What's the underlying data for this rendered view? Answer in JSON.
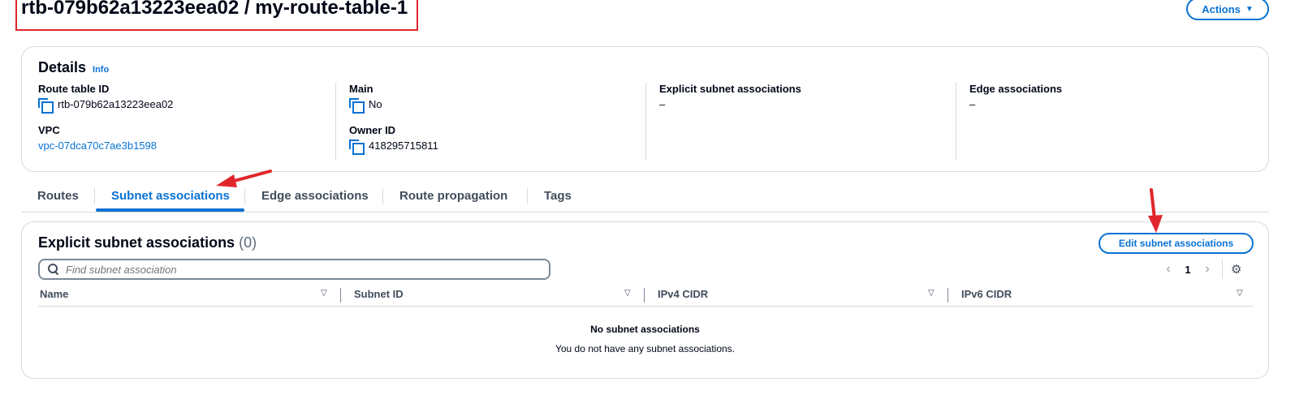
{
  "header": {
    "title": "rtb-079b62a13223eea02 / my-route-table-1",
    "actions_label": "Actions"
  },
  "details": {
    "title": "Details",
    "info_label": "Info",
    "route_table_id_label": "Route table ID",
    "route_table_id_value": "rtb-079b62a13223eea02",
    "vpc_label": "VPC",
    "vpc_value": "vpc-07dca70c7ae3b1598",
    "main_label": "Main",
    "main_value": "No",
    "owner_id_label": "Owner ID",
    "owner_id_value": "418295715811",
    "explicit_label": "Explicit subnet associations",
    "explicit_value": "–",
    "edge_label": "Edge associations",
    "edge_value": "–"
  },
  "tabs": [
    {
      "label": "Routes"
    },
    {
      "label": "Subnet associations"
    },
    {
      "label": "Edge associations"
    },
    {
      "label": "Route propagation"
    },
    {
      "label": "Tags"
    }
  ],
  "associations": {
    "title": "Explicit subnet associations",
    "count": "(0)",
    "edit_label": "Edit subnet associations",
    "search_placeholder": "Find subnet association",
    "page": "1",
    "columns": [
      "Name",
      "Subnet ID",
      "IPv4 CIDR",
      "IPv6 CIDR"
    ],
    "empty_title": "No subnet associations",
    "empty_desc": "You do not have any subnet associations."
  },
  "colors": {
    "accent": "#0972d3",
    "annotation": "#e0262b"
  }
}
